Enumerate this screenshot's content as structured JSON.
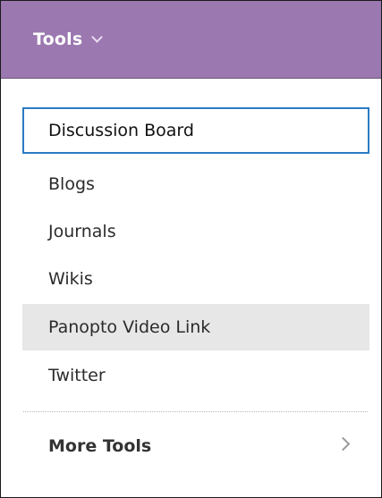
{
  "header": {
    "title": "Tools",
    "color": "#9b78b0"
  },
  "menu": {
    "items": [
      {
        "label": "Discussion Board",
        "state": "focused"
      },
      {
        "label": "Blogs",
        "state": "normal"
      },
      {
        "label": "Journals",
        "state": "normal"
      },
      {
        "label": "Wikis",
        "state": "normal"
      },
      {
        "label": "Panopto Video Link",
        "state": "hovered"
      },
      {
        "label": "Twitter",
        "state": "normal"
      }
    ],
    "more_label": "More Tools"
  },
  "colors": {
    "focus_border": "#2b7bc4",
    "hover_background": "#e7e7e7"
  }
}
